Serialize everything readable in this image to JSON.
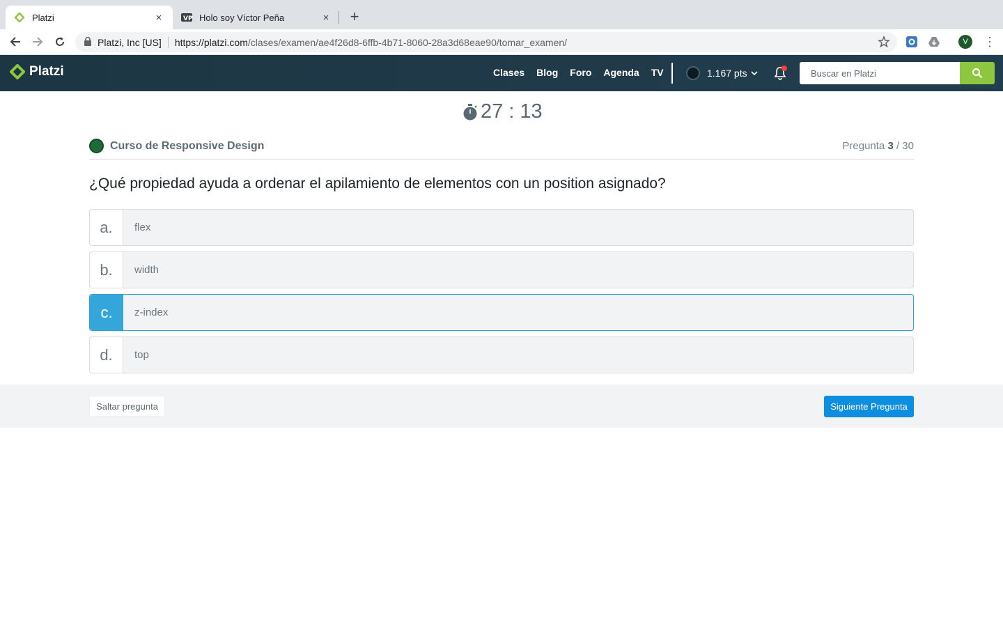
{
  "browser": {
    "tabs": [
      {
        "title": "Platzi",
        "close": "×"
      },
      {
        "title": "Holo soy Víctor Peña",
        "close": "×"
      }
    ],
    "new_tab": "+",
    "site_info": "Platzi, Inc [US]",
    "url_host": "https://platzi.com",
    "url_path": "/clases/examen/ae4f26d8-6ffb-4b71-8060-28a3d68eae90/tomar_examen/",
    "profile_initial": "V",
    "menu": "⋮"
  },
  "header": {
    "logo": "Platzi",
    "nav": [
      "Clases",
      "Blog",
      "Foro",
      "Agenda",
      "TV"
    ],
    "points": "1.167 pts",
    "search_placeholder": "Buscar en Platzi",
    "accent_color": "#8dc63f"
  },
  "exam": {
    "timer": "27 : 13",
    "course": "Curso de Responsive Design",
    "question_label": "Pregunta",
    "question_current": "3",
    "question_total": "/ 30",
    "question": "¿Qué propiedad ayuda a ordenar el apilamiento de elementos con un position asignado?",
    "options": [
      {
        "letter": "a.",
        "text": "flex"
      },
      {
        "letter": "b.",
        "text": "width"
      },
      {
        "letter": "c.",
        "text": "z-index",
        "selected": true
      },
      {
        "letter": "d.",
        "text": "top"
      }
    ],
    "skip_label": "Saltar pregunta",
    "next_label": "Siguiente Pregunta",
    "selected_color": "#34a6d9"
  }
}
